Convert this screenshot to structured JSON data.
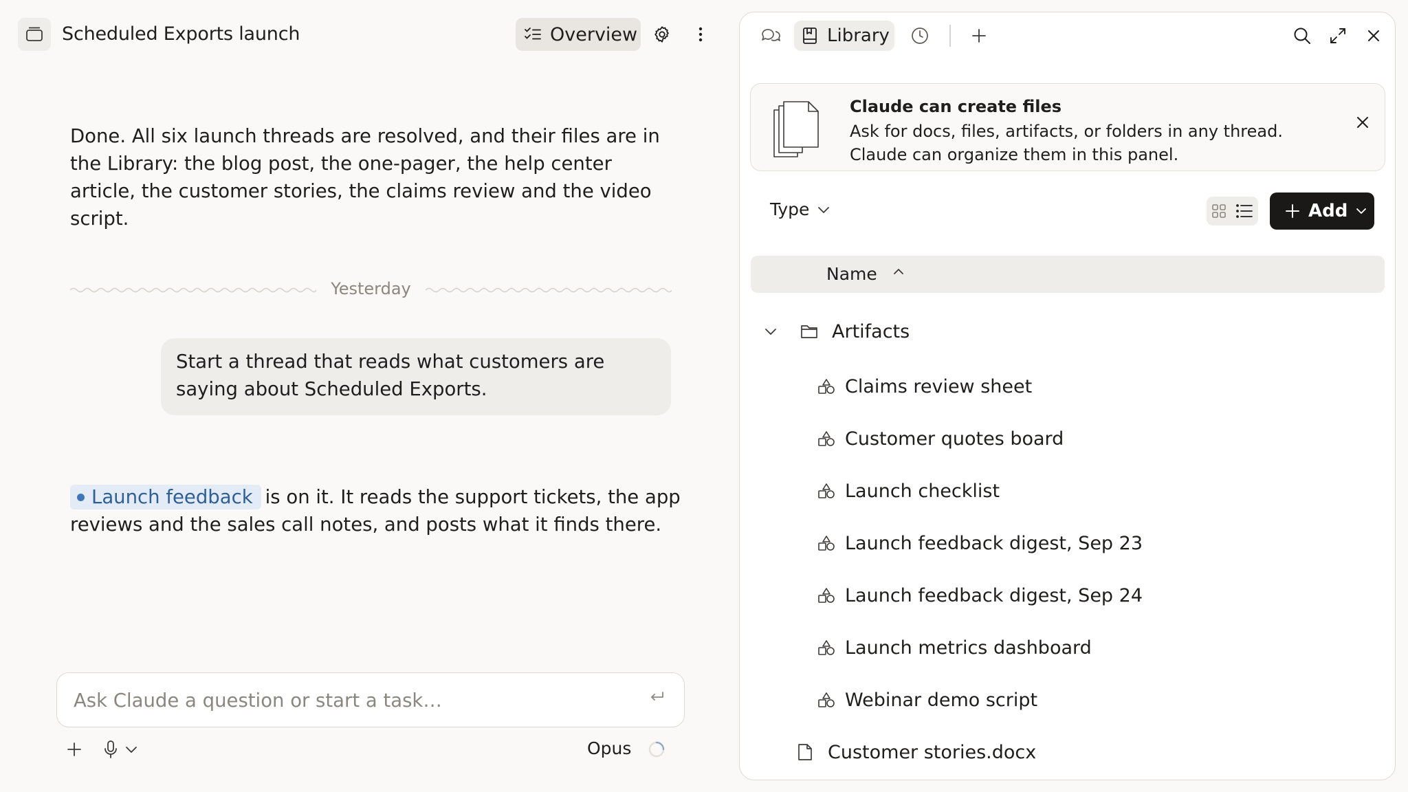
{
  "chat": {
    "title": "Scheduled Exports launch",
    "overview_label": "Overview",
    "assistant_message_1": "Done. All six launch threads are resolved, and their files are in the Library: the blog post, the one-pager, the help center article, the customer stories, the claims review and the video script.",
    "date_divider": "Yesterday",
    "user_message": "Start a thread that reads what customers are saying about Scheduled Exports.",
    "thread_chip_label": "Launch feedback",
    "assistant_message_2_rest": "is on it. It reads the support tickets, the app reviews and the sales call notes, and posts what it finds there.",
    "composer_placeholder": "Ask Claude a question or start a task…",
    "model_label": "Opus"
  },
  "library": {
    "tab_label": "Library",
    "banner": {
      "title": "Claude can create files",
      "body": "Ask for docs, files, artifacts, or folders in any thread. Claude can organize them in this panel."
    },
    "type_filter_label": "Type",
    "add_label": "Add",
    "column_name_label": "Name",
    "folder": {
      "label": "Artifacts",
      "items": [
        "Claims review sheet",
        "Customer quotes board",
        "Launch checklist",
        "Launch feedback digest, Sep 23",
        "Launch feedback digest, Sep 24",
        "Launch metrics dashboard",
        "Webinar demo script"
      ]
    },
    "file_label": "Customer stories.docx"
  },
  "icons": {
    "sidebar": "sidebar-toggle-icon",
    "overview": "checklist-icon",
    "settings": "gear-icon",
    "more": "more-vertical-icon",
    "threads": "chat-bubbles-icon",
    "library": "book-icon",
    "history": "clock-icon",
    "new_tab": "plus-icon",
    "search": "search-icon",
    "expand": "expand-icon",
    "close": "close-icon",
    "artifact": "artifact-shapes-icon",
    "folder": "folder-icon",
    "file": "document-icon"
  },
  "colors": {
    "background": "#faf9f7",
    "panel": "#ffffff",
    "chip_bg": "#e3ecf6",
    "chip_text": "#2f5f93",
    "button_dark": "#1a1918"
  }
}
